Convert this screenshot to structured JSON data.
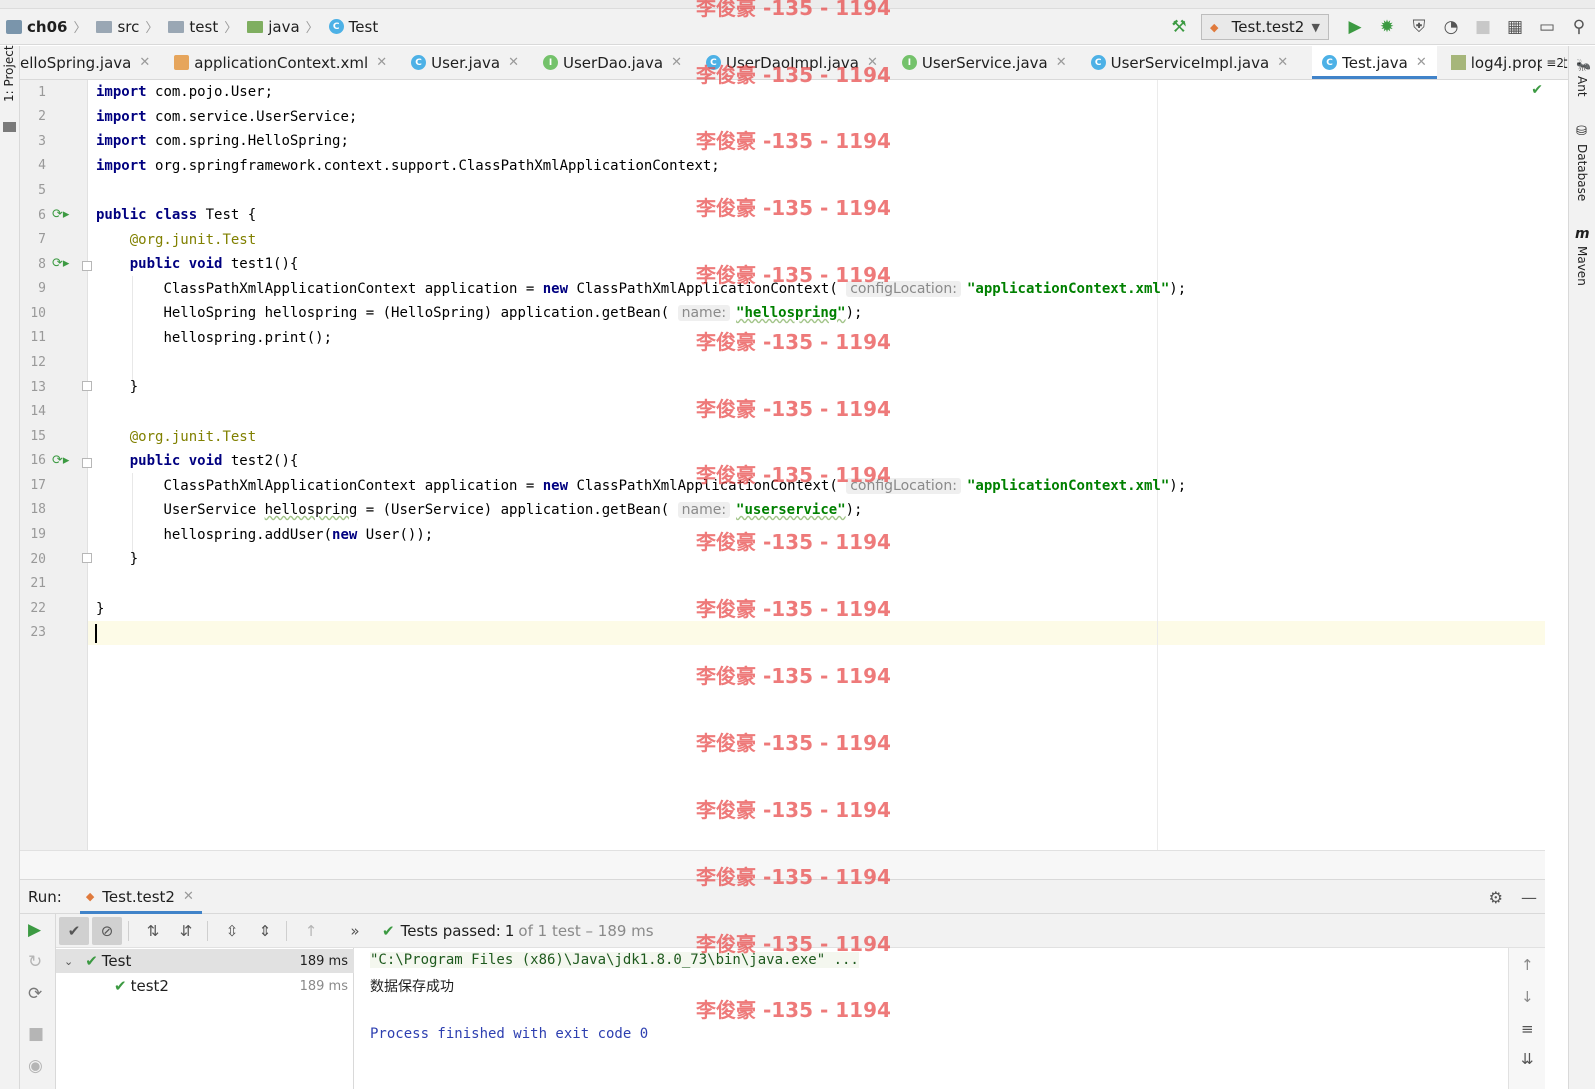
{
  "breadcrumb": {
    "project": "ch06",
    "items": [
      "src",
      "test",
      "java",
      "Test"
    ]
  },
  "toolbar": {
    "run_config": "Test.test2"
  },
  "left_strip": {
    "project_label": "1: Project"
  },
  "right_strip": {
    "ant": "Ant",
    "database": "Database",
    "maven": "Maven"
  },
  "tabs": [
    {
      "label": "elloSpring.java",
      "icon": "class-icon",
      "active": false
    },
    {
      "label": "applicationContext.xml",
      "icon": "xml-icon",
      "active": false
    },
    {
      "label": "User.java",
      "icon": "class-icon",
      "active": false
    },
    {
      "label": "UserDao.java",
      "icon": "interface-icon",
      "active": false
    },
    {
      "label": "UserDaoImpl.java",
      "icon": "class-icon",
      "active": false
    },
    {
      "label": "UserService.java",
      "icon": "interface-icon",
      "active": false
    },
    {
      "label": "UserServiceImpl.java",
      "icon": "class-icon",
      "active": false
    },
    {
      "label": "Test.java",
      "icon": "class-icon",
      "active": true
    },
    {
      "label": "log4j.properties",
      "icon": "properties-icon",
      "active": false
    }
  ],
  "tab_overflow": "≡2",
  "editor": {
    "line_numbers": [
      "1",
      "2",
      "3",
      "4",
      "5",
      "6",
      "7",
      "8",
      "9",
      "10",
      "11",
      "12",
      "13",
      "14",
      "15",
      "16",
      "17",
      "18",
      "19",
      "20",
      "21",
      "22",
      "23"
    ],
    "kw_import": "import",
    "imports": [
      "com.pojo.User;",
      "com.service.UserService;",
      "com.spring.HelloSpring;",
      "org.springframework.context.support.ClassPathXmlApplicationContext;"
    ],
    "kw_public": "public",
    "kw_class": "class",
    "kw_void": "void",
    "kw_new": "new",
    "class_decl": " Test {",
    "annotation_prefix": "@org.junit.",
    "annotation_name": "Test",
    "test1_sig": " test1(){",
    "test2_sig": " test2(){",
    "ctx_decl": "ClassPathXmlApplicationContext application = ",
    "ctx_ctor": " ClassPathXmlApplicationContext(",
    "hint_config": "configLocation:",
    "ctx_arg": "\"applicationContext.xml\"",
    "stmt_end": ");",
    "hello_decl": "HelloSpring hellospring = (HelloSpring) application.getBean(",
    "hint_name": "name:",
    "hello_arg": "\"hellospring\"",
    "hello_print": "hellospring.print();",
    "service_type": "UserService ",
    "service_var": "hellospring",
    "service_rest": " = (UserService) application.getBean(",
    "service_arg": "\"userservice\"",
    "adduser_a": "hellospring.addUser(",
    "adduser_b": " User());",
    "close_brace": "}"
  },
  "run_panel": {
    "label": "Run:",
    "tab": "Test.test2",
    "status_prefix": "Tests passed: ",
    "status_count": "1",
    "status_detail": "of 1 test – 189 ms",
    "tree": [
      {
        "name": "Test",
        "time": "189 ms"
      },
      {
        "name": "test2",
        "time": "189 ms"
      }
    ],
    "console": [
      "\"C:\\Program Files (x86)\\Java\\jdk1.8.0_73\\bin\\java.exe\" ...",
      "数据保存成功",
      "",
      "Process finished with exit code 0"
    ]
  },
  "watermark": "李俊豪 -135 - 1194",
  "colors": {
    "keyword": "#000080",
    "string": "#008000",
    "annotation": "#808000",
    "accent": "#4083c9",
    "success": "#3c9a42",
    "watermark": "#e84646"
  }
}
